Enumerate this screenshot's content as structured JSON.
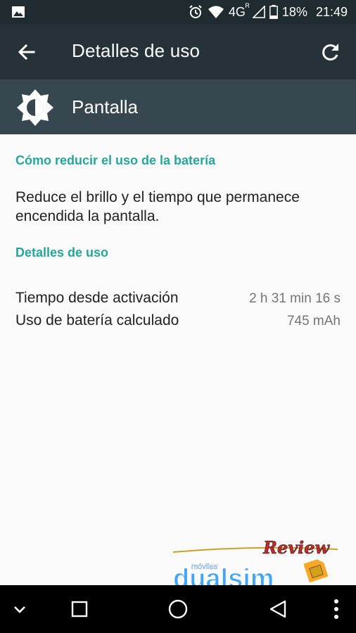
{
  "status_bar": {
    "battery_percent": "18%",
    "time": "21:49",
    "network": "4G",
    "network_suffix": "R"
  },
  "toolbar": {
    "title": "Detalles de uso"
  },
  "app_header": {
    "name": "Pantalla"
  },
  "reduce_section": {
    "title": "Cómo reducir el uso de la batería",
    "tip": "Reduce el brillo y el tiempo que permanece encendida la pantalla."
  },
  "details_section": {
    "title": "Detalles de uso",
    "rows": [
      {
        "label": "Tiempo desde activación",
        "value": "2 h 31 min 16 s"
      },
      {
        "label": "Uso de batería calculado",
        "value": "745 mAh"
      }
    ]
  },
  "watermark": {
    "top_text": "Review",
    "small_text": "móviles",
    "brand": "dualsim"
  },
  "colors": {
    "accent": "#26a69a",
    "toolbar": "#263238",
    "header": "#37474f"
  }
}
